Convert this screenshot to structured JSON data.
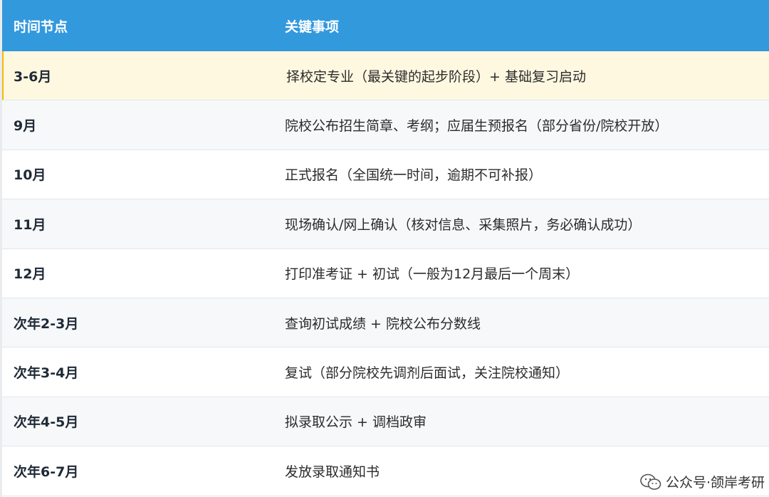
{
  "table": {
    "headers": [
      "时间节点",
      "关键事项"
    ],
    "rows": [
      {
        "time": "3-6月",
        "item": "择校定专业（最关键的起步阶段）+ 基础复习启动"
      },
      {
        "time": "9月",
        "item": "院校公布招生简章、考纲；应届生预报名（部分省份/院校开放）"
      },
      {
        "time": "10月",
        "item": "正式报名（全国统一时间，逾期不可补报）"
      },
      {
        "time": "11月",
        "item": "现场确认/网上确认（核对信息、采集照片，务必确认成功）"
      },
      {
        "time": "12月",
        "item": "打印准考证 + 初试（一般为12月最后一个周末）"
      },
      {
        "time": "次年2-3月",
        "item": "查询初试成绩 + 院校公布分数线"
      },
      {
        "time": "次年3-4月",
        "item": "复试（部分院校先调剂后面试，关注院校通知）"
      },
      {
        "time": "次年4-5月",
        "item": "拟录取公示 + 调档政审"
      },
      {
        "time": "次年6-7月",
        "item": "发放录取通知书"
      }
    ]
  },
  "watermark": {
    "text": "公众号·颌岸考研",
    "icon": "wechat-icon"
  },
  "colors": {
    "header_bg": "#3399dd",
    "highlight_bg": "#fff8e1",
    "highlight_bar": "#f6b800"
  }
}
